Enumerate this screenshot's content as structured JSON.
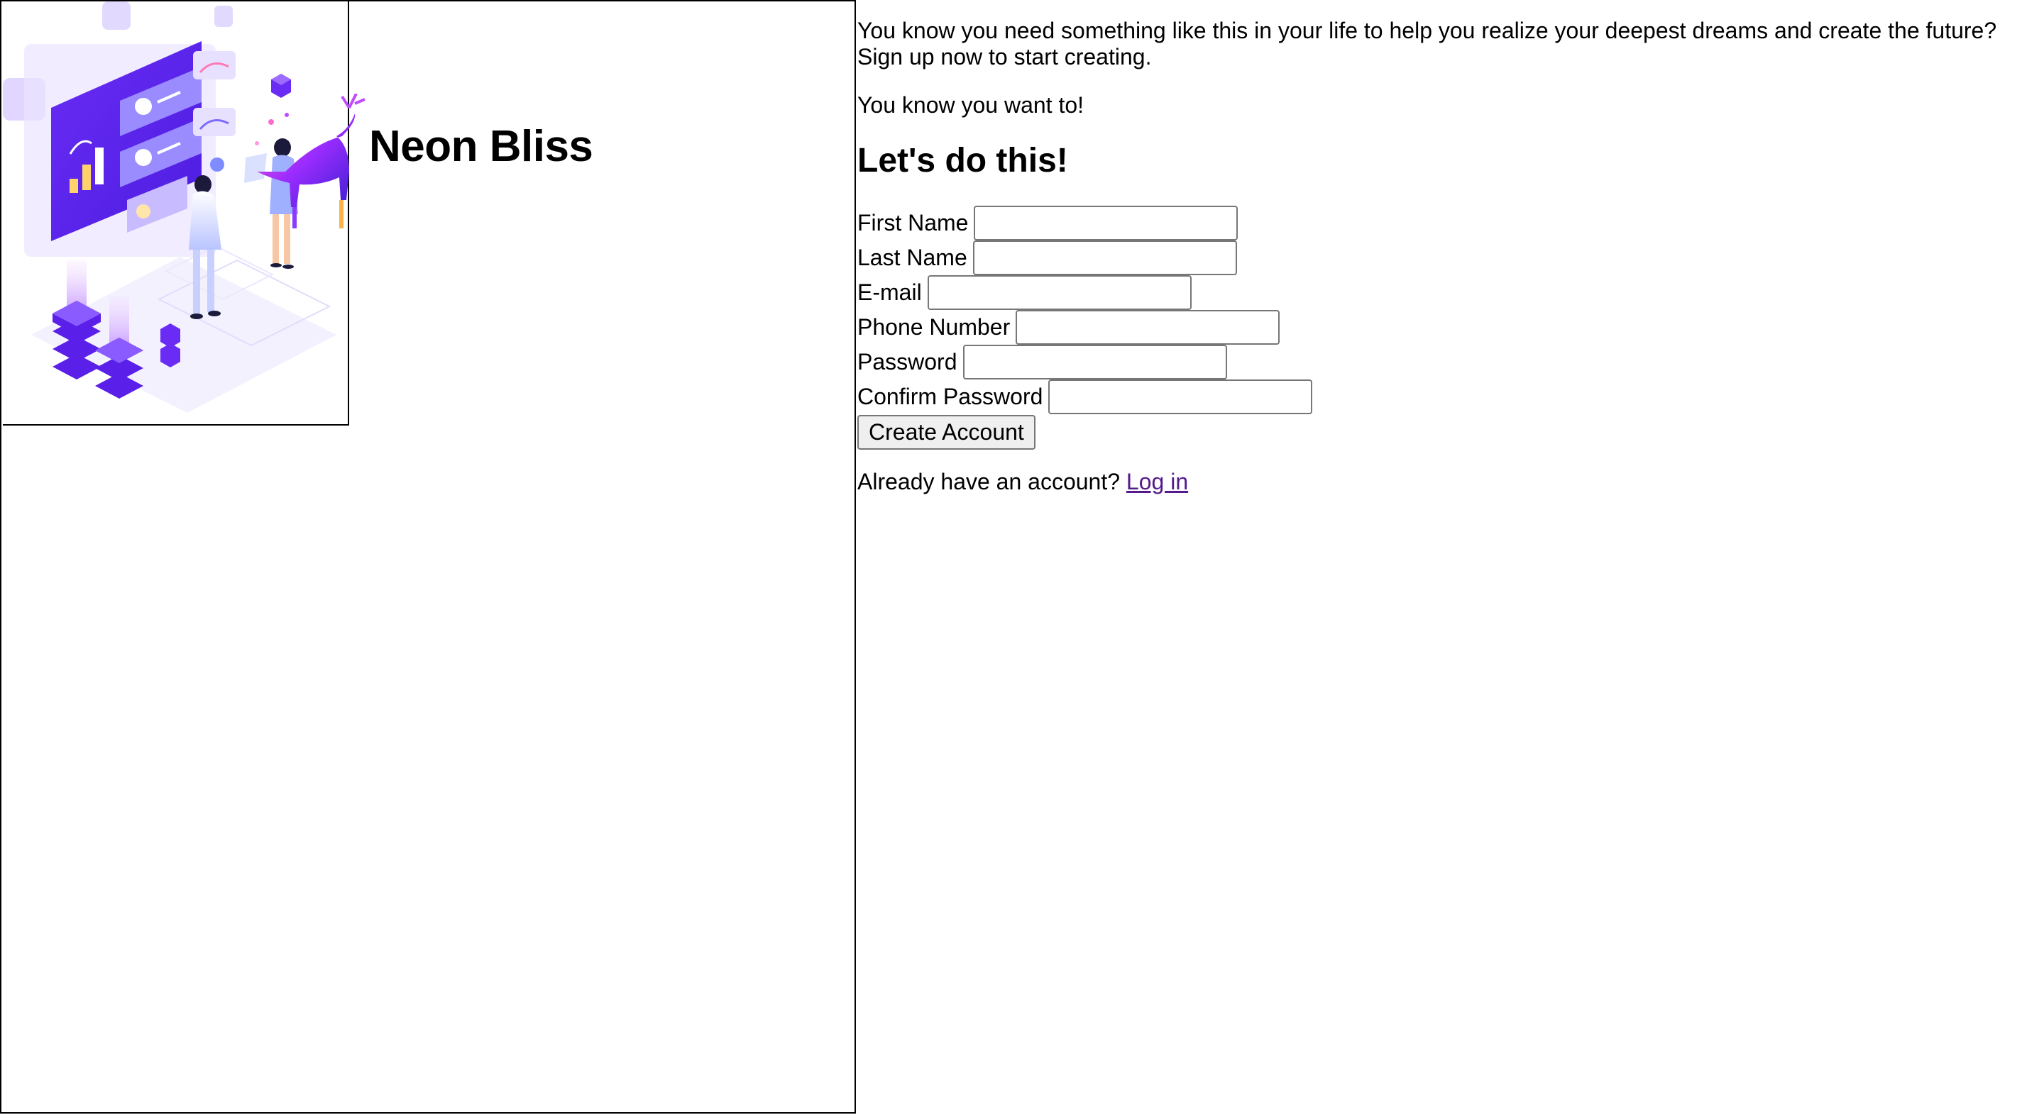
{
  "brand": {
    "name": "Neon Bliss"
  },
  "intro": {
    "text": "You know you need something like this in your life to help you realize your deepest dreams and create the future? Sign up now to start creating.",
    "tagline": "You know you want to!"
  },
  "form": {
    "heading": "Let's do this!",
    "fields": [
      {
        "label": "First Name",
        "value": ""
      },
      {
        "label": "Last Name",
        "value": ""
      },
      {
        "label": "E-mail",
        "value": ""
      },
      {
        "label": "Phone Number",
        "value": ""
      },
      {
        "label": "Password",
        "value": ""
      },
      {
        "label": "Confirm Password",
        "value": ""
      }
    ],
    "submit_label": "Create Account"
  },
  "login": {
    "prompt": "Already have an account?",
    "link_label": "Log in",
    "link_color": "#551a8b"
  },
  "colors": {
    "accent": "#5b21f0",
    "accent_light": "#c9b8ff"
  }
}
